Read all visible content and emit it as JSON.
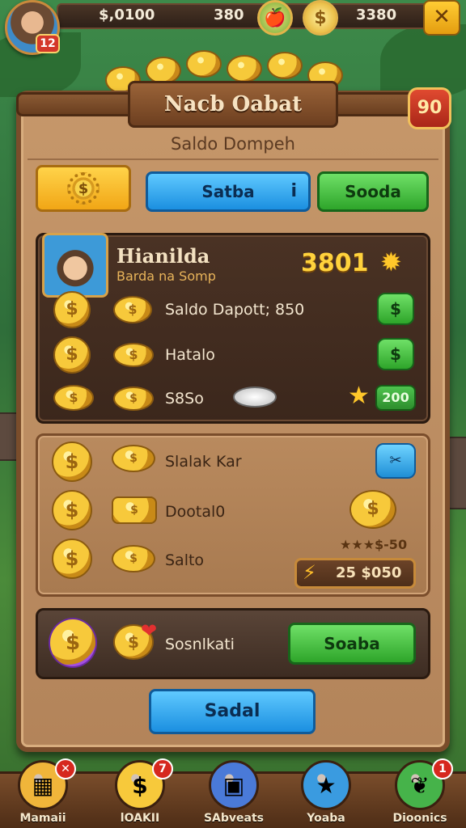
{
  "hud": {
    "avatar_level": "12",
    "balance_a": "$,0100",
    "balance_b": "380",
    "balance_c": "3380",
    "close_label": "✕"
  },
  "panel": {
    "title": "Nacb Oabat",
    "level_badge": "90",
    "subtitle": "Saldo Dompeh",
    "gear_symbol": "$",
    "saldo_button": "Satba",
    "info_symbol": "i",
    "sooda_button": "Sooda"
  },
  "player": {
    "name": "Hianilda",
    "subtitle": "Barda na Somp",
    "score": "3801"
  },
  "dark_rows": [
    {
      "label": "Saldo Dapott; 850",
      "button": "$"
    },
    {
      "label": "Hatalo",
      "button": "$"
    },
    {
      "label": "S8So",
      "badge": "200"
    }
  ],
  "light_rows": [
    {
      "label": "Slalak Kar",
      "button": "✂"
    },
    {
      "label": "Dootal0"
    },
    {
      "label": "Salto"
    }
  ],
  "reward": {
    "stars_text": "★★★$-50",
    "amount": "25 $050"
  },
  "bar": {
    "label": "Sosnlkati",
    "button": "Soaba"
  },
  "bottom_button": "Sadal",
  "nav": [
    {
      "label": "Mamaii",
      "badge": "✕",
      "icon": "map-icon",
      "glyph": "▦",
      "color": "#f0b53a"
    },
    {
      "label": "lOAKII",
      "badge": "7",
      "icon": "coin-icon",
      "glyph": "$",
      "color": "#f7c93b"
    },
    {
      "label": "SAbveats",
      "badge": "",
      "icon": "shield-icon",
      "glyph": "▣",
      "color": "#4a7ad8"
    },
    {
      "label": "Yoaba",
      "badge": "",
      "icon": "star-icon",
      "glyph": "★",
      "color": "#3a9be0"
    },
    {
      "label": "Dioonics",
      "badge": "1",
      "icon": "leaf-icon",
      "glyph": "❦",
      "color": "#46b34a"
    }
  ],
  "colors": {
    "panel": "#b98a5e",
    "accent_gold": "#ffd23c",
    "button_blue": "#1b8fe0",
    "button_green": "#2ea52a"
  }
}
